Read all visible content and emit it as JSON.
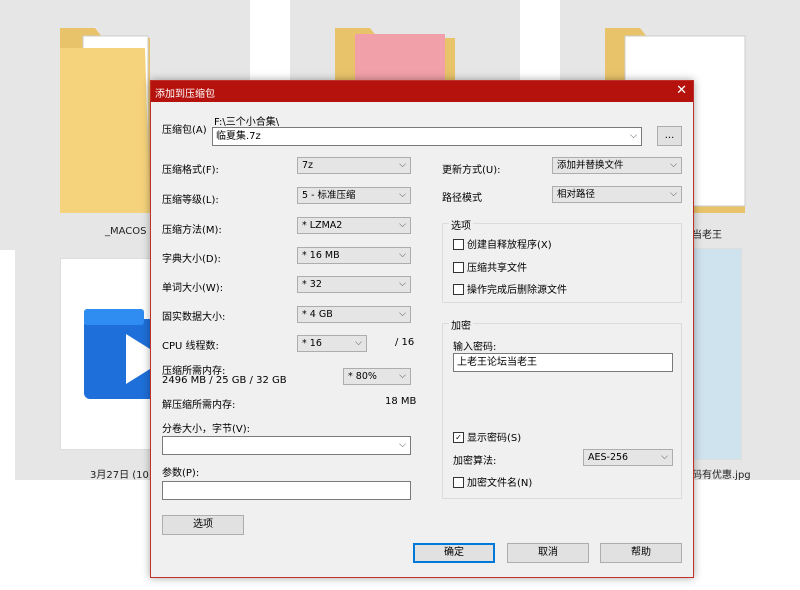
{
  "background": {
    "captions": [
      "_MACOS",
      "当老王",
      "3月27日 (10)",
      "码有优惠.jpg"
    ]
  },
  "dialog": {
    "title": "添加到压缩包",
    "close_icon": "close-icon",
    "archive_label": "压缩包(A)",
    "archive_path": "F:\\三个小合集\\",
    "archive_name": "临夏集.7z",
    "browse_label": "...",
    "left": {
      "format_label": "压缩格式(F):",
      "format_value": "7z",
      "level_label": "压缩等级(L):",
      "level_value": "5 - 标准压缩",
      "method_label": "压缩方法(M):",
      "method_value": "* LZMA2",
      "dict_label": "字典大小(D):",
      "dict_value": "* 16 MB",
      "word_label": "单词大小(W):",
      "word_value": "* 32",
      "solid_label": "固实数据大小:",
      "solid_value": "* 4 GB",
      "cpu_label": "CPU 线程数:",
      "cpu_value": "* 16",
      "cpu_total": "/ 16",
      "mem_label": "压缩所需内存:",
      "mem_detail": "2496 MB / 25 GB / 32 GB",
      "mem_percent": "* 80%",
      "decomp_label": "解压缩所需内存:",
      "decomp_value": "18 MB",
      "split_label": "分卷大小，字节(V):",
      "split_value": "",
      "params_label": "参数(P):",
      "params_value": "",
      "options_button": "选项"
    },
    "right": {
      "update_label": "更新方式(U):",
      "update_value": "添加并替换文件",
      "path_label": "路径模式",
      "path_value": "相对路径",
      "options_group": "选项",
      "opt_sfx": "创建自释放程序(X)",
      "opt_shared": "压缩共享文件",
      "opt_delete": "操作完成后删除源文件",
      "encrypt_group": "加密",
      "password_label": "输入密码:",
      "password_value": "上老王论坛当老王",
      "show_password": "显示密码(S)",
      "show_password_checked": true,
      "algo_label": "加密算法:",
      "algo_value": "AES-256",
      "encrypt_names": "加密文件名(N)"
    },
    "buttons": {
      "ok": "确定",
      "cancel": "取消",
      "help": "帮助"
    }
  }
}
